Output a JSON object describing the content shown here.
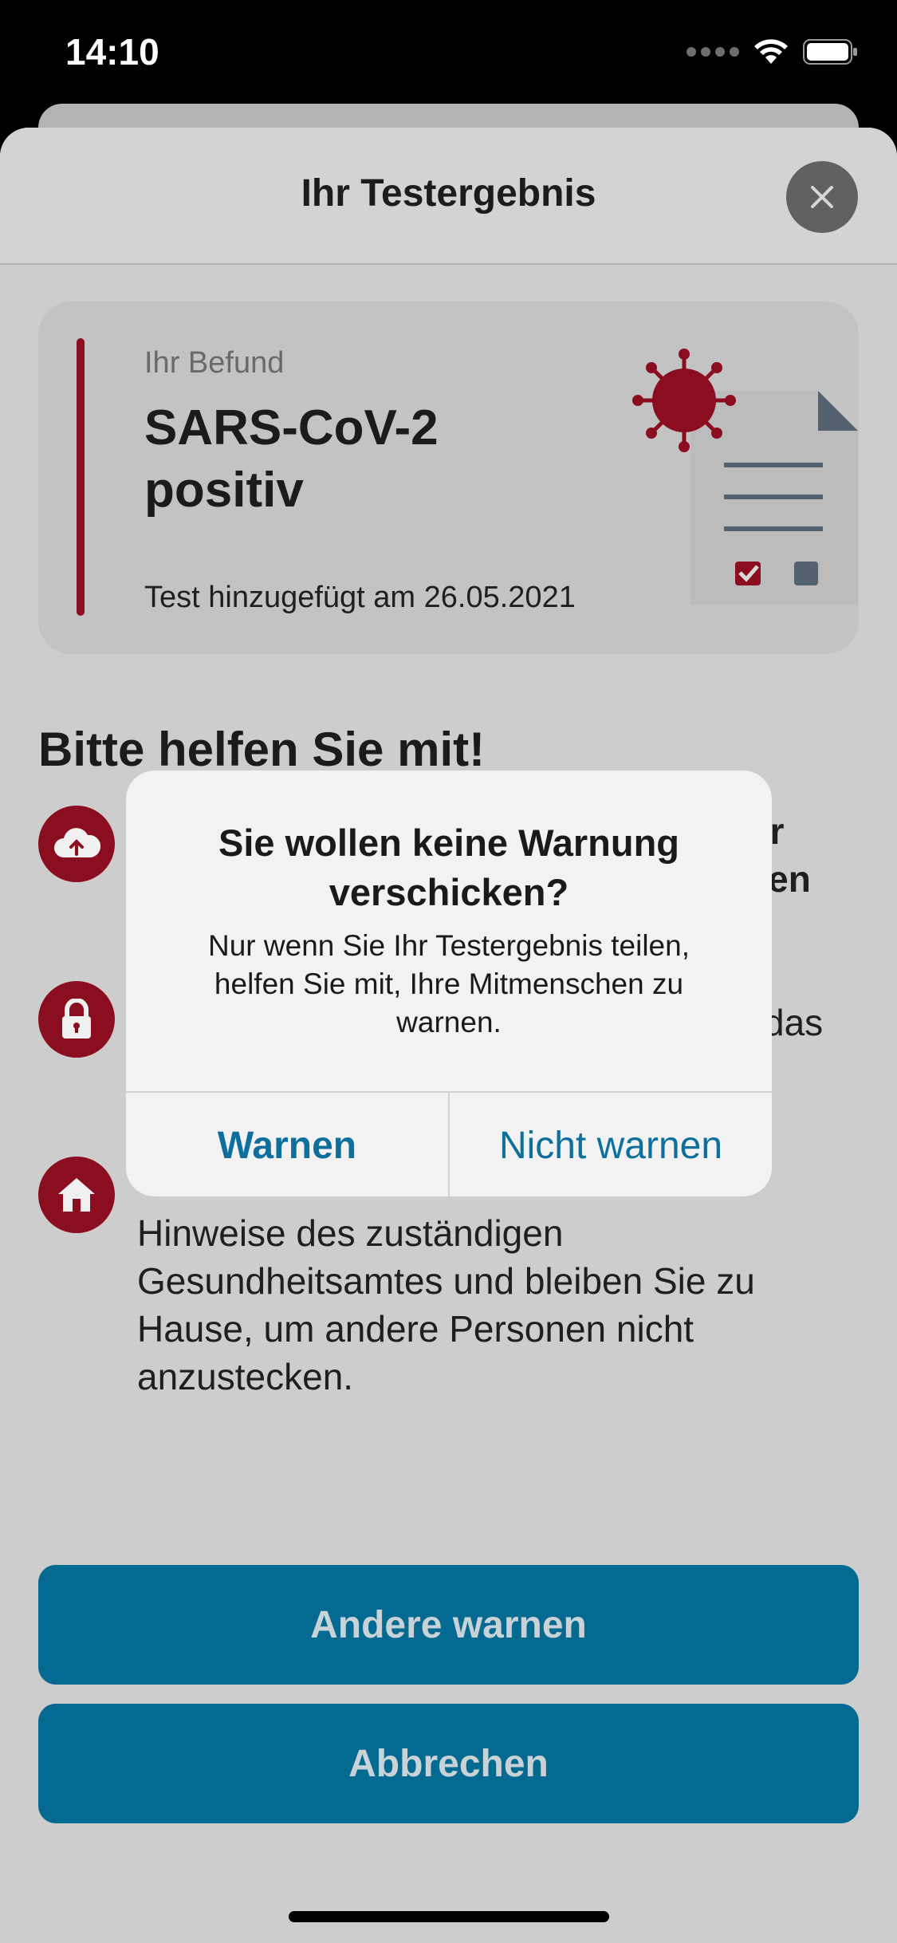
{
  "status_bar": {
    "time": "14:10"
  },
  "sheet": {
    "title": "Ihr Testergebnis"
  },
  "result_card": {
    "label": "Ihr Befund",
    "value": "SARS-CoV-2 positiv",
    "date_text": "Test hinzugefügt am 26.05.2021",
    "accent_color": "#8a0e20"
  },
  "help": {
    "title": "Bitte helfen Sie mit!",
    "items": [
      {
        "icon": "cloud-upload-icon",
        "text": "vor\neilen"
      },
      {
        "icon": "lock-icon",
        "text": "das"
      },
      {
        "icon": "home-icon",
        "text": "Hinweise des zuständigen Gesundheitsamtes und bleiben Sie zu Hause, um andere Personen nicht anzustecken."
      }
    ]
  },
  "buttons": {
    "warn_others": "Andere warnen",
    "cancel": "Abbrechen",
    "color": "#046a91"
  },
  "alert": {
    "title": "Sie wollen keine Warnung verschicken?",
    "message": "Nur wenn Sie Ihr Testergebnis teilen, helfen Sie mit, Ihre Mitmenschen zu warnen.",
    "primary_button": "Warnen",
    "secondary_button": "Nicht warnen",
    "button_color": "#0e6f9c"
  }
}
